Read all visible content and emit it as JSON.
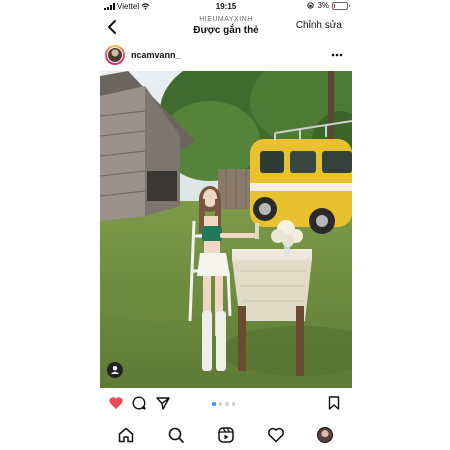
{
  "status_bar": {
    "carrier": "Viettel",
    "time": "19:15",
    "battery": "3%",
    "battery_level": 0.03,
    "battery_color": "#dd3333"
  },
  "nav": {
    "account_handle": "HIEUMAYXINH",
    "title": "Được gắn thẻ",
    "edit_label": "Chỉnh sửa",
    "back_icon": "chevron-left-icon"
  },
  "post": {
    "username": "ncamvann_",
    "more_icon": "more-horizontal-icon",
    "photo_icon": "tag-user-icon",
    "liked": true,
    "like_color": "#ed4956",
    "carousel": {
      "count": 4,
      "current": 1,
      "active_color": "#3897f0"
    }
  },
  "actions": [
    "heart-icon",
    "comment-icon",
    "share-icon",
    "bookmark-icon"
  ],
  "tabs": [
    "home-icon",
    "search-icon",
    "reels-icon",
    "heart-icon",
    "profile-avatar"
  ]
}
